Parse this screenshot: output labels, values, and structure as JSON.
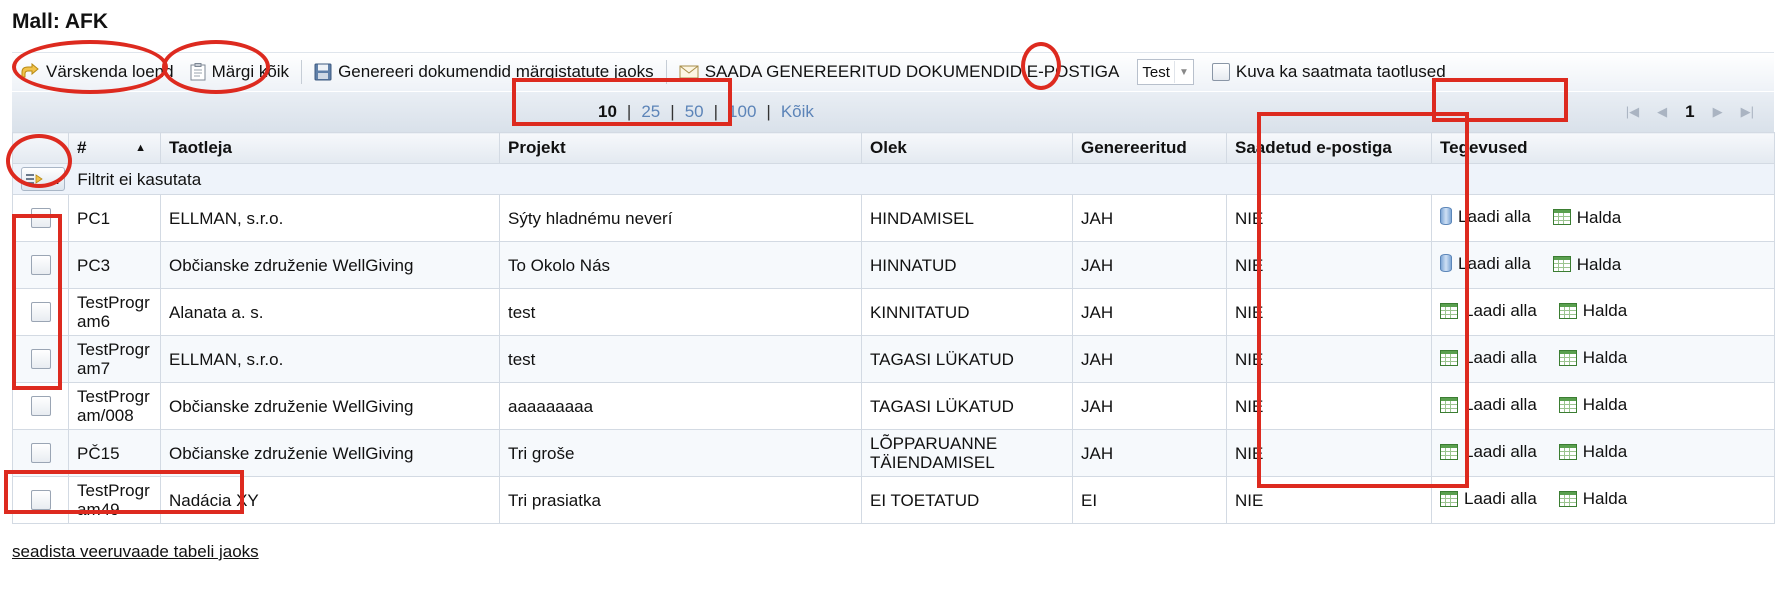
{
  "page_title": "Mall: AFK",
  "toolbar": {
    "refresh_label": "Värskenda loend",
    "mark_all_label": "Märgi kõik",
    "generate_label": "Genereeri dokumendid märgistatute jaoks",
    "send_label": "SAADA GENEREERITUD DOKUMENDID E-POSTIGA",
    "template_select_value": "Test",
    "show_unsent_label": "Kuva ka saatmata taotlused"
  },
  "pager": {
    "sizes": [
      "10",
      "25",
      "50",
      "100",
      "Kõik"
    ],
    "current_page": "1"
  },
  "table": {
    "headers": [
      "#",
      "Taotleja",
      "Projekt",
      "Olek",
      "Genereeritud",
      "Saadetud e-postiga",
      "Tegevused"
    ],
    "filter_text": "Filtrit ei kasutata",
    "filter_button_label": "...",
    "action_download": "Laadi alla",
    "action_manage": "Halda",
    "rows": [
      {
        "id": "PC1",
        "applicant": "ELLMAN, s.r.o.",
        "project": "Sýty hladnému neverí",
        "status": "HINDAMISEL",
        "generated": "JAH",
        "sent": "NIE",
        "download_icon": "db"
      },
      {
        "id": "PC3",
        "applicant": "Občianske združenie WellGiving",
        "project": "To Okolo Nás",
        "status": "HINNATUD",
        "generated": "JAH",
        "sent": "NIE",
        "download_icon": "db"
      },
      {
        "id": "TestProgram6",
        "applicant": "Alanata a. s.",
        "project": "test",
        "status": "KINNITATUD",
        "generated": "JAH",
        "sent": "NIE",
        "download_icon": "grid"
      },
      {
        "id": "TestProgram7",
        "applicant": "ELLMAN, s.r.o.",
        "project": "test",
        "status": "TAGASI LÜKATUD",
        "generated": "JAH",
        "sent": "NIE",
        "download_icon": "grid"
      },
      {
        "id": "TestProgram/008",
        "applicant": "Občianske združenie WellGiving",
        "project": "aaaaaaaaa",
        "status": "TAGASI LÜKATUD",
        "generated": "JAH",
        "sent": "NIE",
        "download_icon": "grid"
      },
      {
        "id": "PČ15",
        "applicant": "Občianske združenie WellGiving",
        "project": "Tri groše",
        "status": "LÕPPARUANNE TÄIENDAMISEL",
        "generated": "JAH",
        "sent": "NIE",
        "download_icon": "grid"
      },
      {
        "id": "TestProgram49",
        "applicant": "Nadácia XY",
        "project": "Tri prasiatka",
        "status": "EI TOETATUD",
        "generated": "EI",
        "sent": "NIE",
        "download_icon": "grid"
      }
    ]
  },
  "bottom_link": "seadista veeruvaade tabeli jaoks",
  "colors": {
    "highlight": "#dd2a1f",
    "link": "#5c84b8"
  }
}
